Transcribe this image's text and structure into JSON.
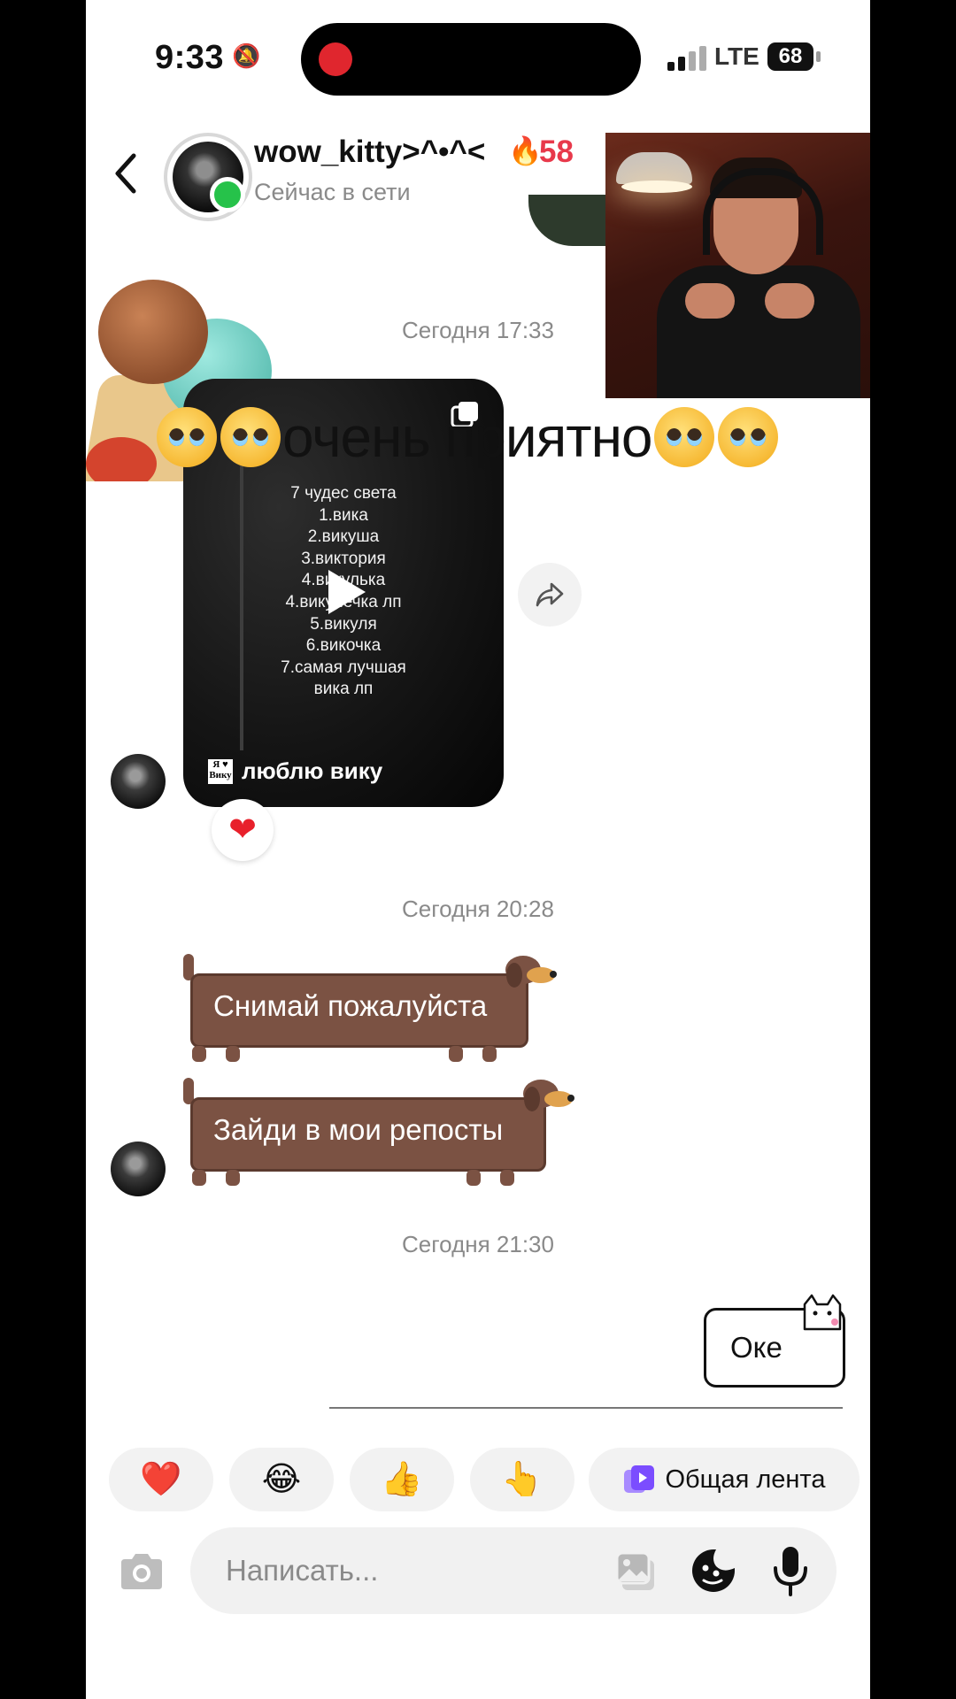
{
  "status_bar": {
    "time": "9:33",
    "network": "LTE",
    "battery": "68"
  },
  "header": {
    "back_icon": "chevron-left-icon",
    "contact_name": "wow_kitty>^•^<",
    "streak_count": "58",
    "streak_icon": "fire-icon",
    "presence": "Сейчас в сети"
  },
  "chat": {
    "sections": [
      {
        "timestamp": "Сегодня 17:33"
      },
      {
        "timestamp": "Сегодня 20:28"
      },
      {
        "timestamp": "Сегодня 21:30"
      }
    ],
    "overlay_caption": "очень приятно",
    "shared_video": {
      "lines": [
        "7 чудес света",
        "1.вика",
        "2.викуша",
        "3.виктория",
        "4.викулька",
        "4.викулечка лп",
        "5.викуля",
        "6.викочка",
        "7.самая лучшая",
        "вика лп"
      ],
      "badge_text": "Я ♥ Вику",
      "caption": "люблю вику",
      "reaction": "❤"
    },
    "received_messages": [
      {
        "text": "Снимай пожалуйста"
      },
      {
        "text": "Зайди в мои репосты"
      }
    ],
    "sent_messages": [
      {
        "text": "Оке"
      }
    ]
  },
  "quick_reactions": {
    "chips": [
      "❤️",
      "😂",
      "👍",
      "👆"
    ],
    "feed_label": "Общая лента"
  },
  "composer": {
    "placeholder": "Написать..."
  },
  "colors": {
    "streak": "#e8394b",
    "online": "#26c24a",
    "bubble_brown": "#7b5243",
    "feed_purple": "#7b4dff"
  }
}
